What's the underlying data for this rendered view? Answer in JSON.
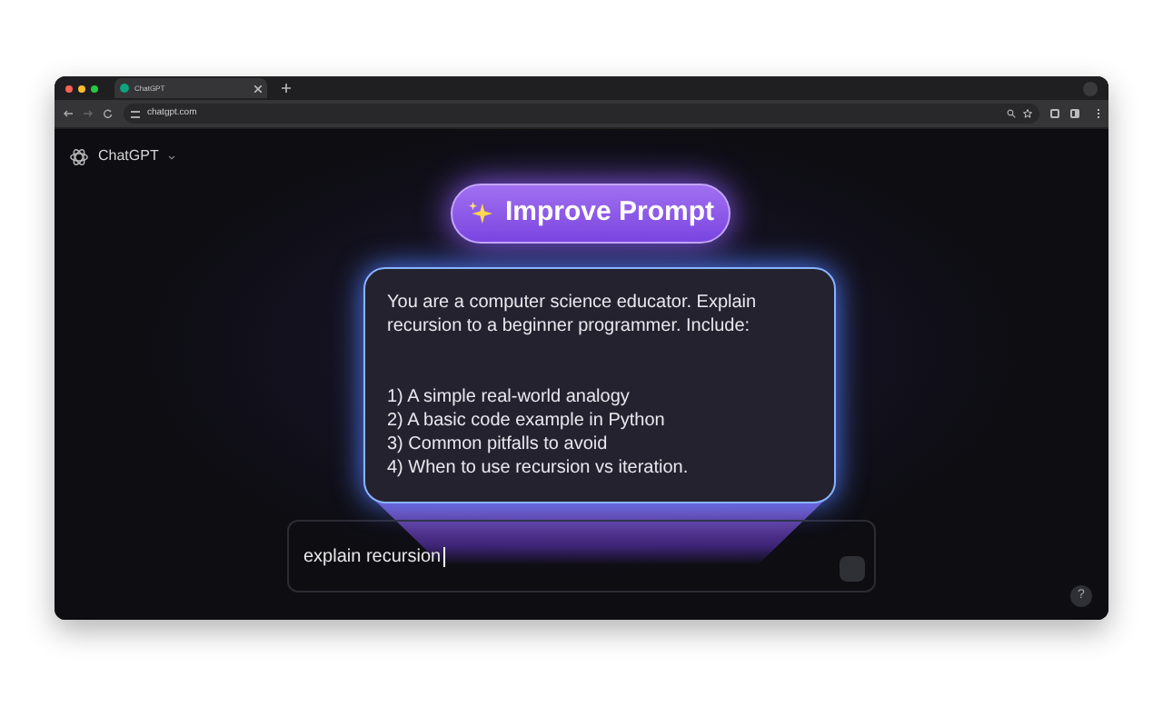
{
  "browser": {
    "tab": {
      "title": "ChatGPT",
      "selected": true
    },
    "url": "chatgpt.com"
  },
  "app": {
    "title": "ChatGPT"
  },
  "improve_button": {
    "label": "Improve Prompt"
  },
  "prompt_card": {
    "paragraphs": [
      "You are a computer science educator. Explain recursion to a beginner programmer. Include:"
    ],
    "items": [
      "1) A simple real-world analogy",
      "2) A basic code example in Python",
      "3) Common pitfalls to avoid",
      "4) When to use recursion vs iteration."
    ]
  },
  "composer": {
    "value": "explain recursion"
  },
  "help_button": {
    "label": "?"
  }
}
